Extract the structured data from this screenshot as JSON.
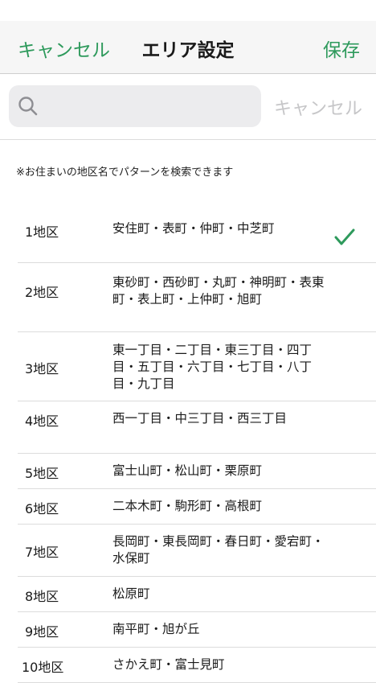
{
  "nav": {
    "cancel": "キャンセル",
    "title": "エリア設定",
    "save": "保存"
  },
  "search": {
    "placeholder": "",
    "cancel": "キャンセル"
  },
  "hint": "※お住まいの地区名でパターンを検索できます",
  "accent_color": "#2e9a5c",
  "districts": [
    {
      "label": "1地区",
      "towns": "安住町・表町・仲町・中芝町",
      "selected": true
    },
    {
      "label": "2地区",
      "towns": "東砂町・西砂町・丸町・神明町・表東町・表上町・上仲町・旭町"
    },
    {
      "label": "3地区",
      "towns": "東一丁目・二丁目・東三丁目・四丁目・五丁目・六丁目・七丁目・八丁目・九丁目"
    },
    {
      "label": "4地区",
      "towns": "西一丁目・中三丁目・西三丁目"
    },
    {
      "label": "5地区",
      "towns": "富士山町・松山町・栗原町"
    },
    {
      "label": "6地区",
      "towns": "二本木町・駒形町・高根町"
    },
    {
      "label": "7地区",
      "towns": "長岡町・東長岡町・春日町・愛宕町・水保町"
    },
    {
      "label": "8地区",
      "towns": "松原町"
    },
    {
      "label": "9地区",
      "towns": "南平町・旭が丘"
    },
    {
      "label": "10地区",
      "towns": "さかえ町・富士見町"
    }
  ]
}
